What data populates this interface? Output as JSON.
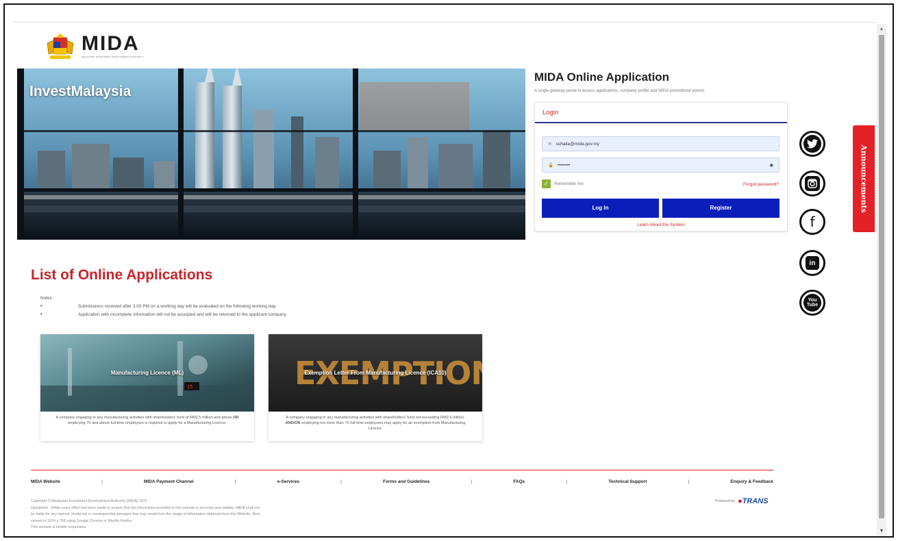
{
  "brand": {
    "name": "MIDA",
    "subtitle": "MALAYSIAN INVESTMENT DEVELOPMENT AUTHORITY"
  },
  "hero": {
    "title": "InvestMalaysia"
  },
  "login_panel": {
    "title": "MIDA Online Application",
    "subtitle": "A single gateway portal to access applications, company profile and MIDA promotional events.",
    "tab": "Login",
    "email_value": "suhaila@mida.gov.my",
    "password_value": "••••••••",
    "remember_label": "Remember me",
    "remember_checked": true,
    "forgot_label": "Forgot password?",
    "login_button": "Log In",
    "register_button": "Register",
    "learn_link": "Learn About the System"
  },
  "social": [
    {
      "name": "twitter-icon",
      "glyph": "🐦"
    },
    {
      "name": "instagram-icon",
      "glyph": "◙"
    },
    {
      "name": "facebook-icon",
      "glyph": "f"
    },
    {
      "name": "linkedin-icon",
      "glyph": "in"
    },
    {
      "name": "youtube-icon",
      "glyph": "You"
    }
  ],
  "announcements_label": "Announcements",
  "list": {
    "title": "List of Online Applications",
    "notes_heading": "Notes :",
    "notes": [
      "Submissions received after 3.00 PM on a working day will be evaluated on the following working day.",
      "Application with incomplete information will not be accepted and will be returned to the applicant company."
    ]
  },
  "cards": [
    {
      "title": "Manufacturing Licence (ML)",
      "description_1": "A company engaging in any manufacturing activities with shareholders' fund of RM2.5 million and above",
      "description_bold": "OR",
      "description_2": " employing 75 and above full-time employees is required to apply for a Manufacturing Licence."
    },
    {
      "title": "Exemption Letter From Manufacturing Licence (ICA10)",
      "image_word": "EXEMPTION",
      "description_1": "A company engaging in any manufacturing activities with shareholders' fund not exceeding RM2.5 million;",
      "description_bold": "AND/OR",
      "description_2": " employing not more than 75 full-time employees may apply for an exemption from Manufacturing Licence."
    }
  ],
  "footer": {
    "links": [
      "MIDA Website",
      "MIDA Payment Channel",
      "e-Services",
      "Forms and Guidelines",
      "FAQs",
      "Technical Support",
      "Enquiry & Feedback"
    ],
    "separator": "|",
    "copyright": "Copyright © Malaysian Investment Development Authority (MIDA) 2021",
    "disclaimer": "Disclaimer : While every effort has been made to ensure that the information provided in this website is accurate and reliable, MIDA shall not be liable for any special, incidental or consequential damages that may result from the usage of information obtained from this Website. Best viewed in 1024 x 768 using Google Chrome or Mozilla Firefox.",
    "mobile_note": "This website is mobile responsive.",
    "powered_by": "Powered by",
    "vendor": "TRANS"
  },
  "colors": {
    "accent_red": "#c8242b",
    "button_blue": "#0a1fba",
    "announce_red": "#e42126",
    "checkbox_green": "#8db33a"
  }
}
